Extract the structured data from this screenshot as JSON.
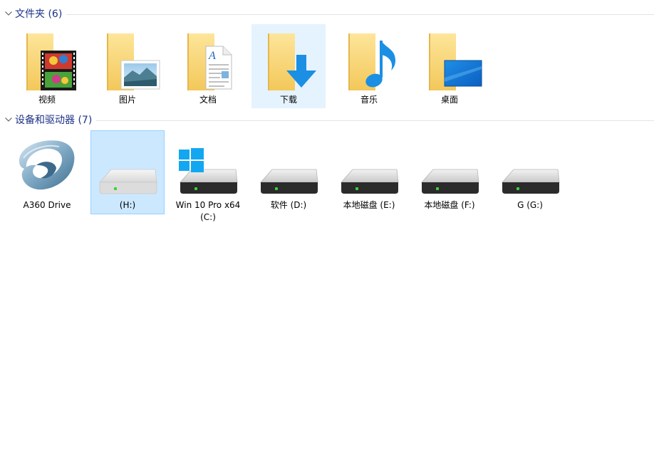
{
  "folders_group": {
    "title": "文件夹 (6)",
    "items": [
      {
        "label": "视频",
        "icon": "videos-folder-icon"
      },
      {
        "label": "图片",
        "icon": "pictures-folder-icon"
      },
      {
        "label": "文档",
        "icon": "documents-folder-icon"
      },
      {
        "label": "下载",
        "icon": "downloads-folder-icon"
      },
      {
        "label": "音乐",
        "icon": "music-folder-icon"
      },
      {
        "label": "桌面",
        "icon": "desktop-folder-icon"
      }
    ]
  },
  "drives_group": {
    "title": "设备和驱动器 (7)",
    "items": [
      {
        "label": "A360 Drive",
        "icon": "a360-drive-icon"
      },
      {
        "label": "(H:)",
        "icon": "hard-drive-icon"
      },
      {
        "label": "Win 10 Pro x64",
        "label2": "(C:)",
        "icon": "system-drive-icon"
      },
      {
        "label": "软件 (D:)",
        "icon": "hard-drive-icon"
      },
      {
        "label": "本地磁盘 (E:)",
        "icon": "hard-drive-icon"
      },
      {
        "label": "本地磁盘 (F:)",
        "icon": "hard-drive-icon"
      },
      {
        "label": "G (G:)",
        "icon": "hard-drive-icon"
      }
    ]
  },
  "colors": {
    "header_text": "#1e3287",
    "hover_bg": "#e5f3ff",
    "selected_bg": "#cce8ff",
    "selected_border": "#99d1ff",
    "folder_yellow": "#f8d775"
  }
}
